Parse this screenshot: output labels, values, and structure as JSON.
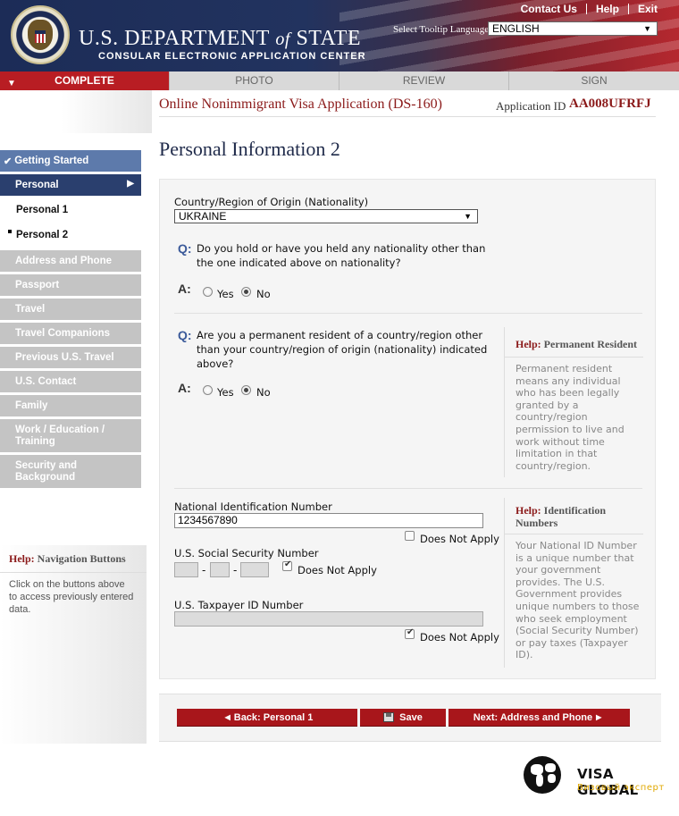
{
  "header": {
    "dept_title_part1": "U.S. Department",
    "dept_title_of": "of",
    "dept_title_part2": "State",
    "center_title": "CONSULAR ELECTRONIC APPLICATION CENTER",
    "top_links": [
      "Contact Us",
      "Help",
      "Exit"
    ],
    "tooltip_language_label": "Select Tooltip Language",
    "tooltip_language_value": "ENGLISH",
    "seal_icon": "department-seal"
  },
  "progress_tabs": [
    {
      "label": "COMPLETE",
      "state": "current"
    },
    {
      "label": "PHOTO",
      "state": "pending"
    },
    {
      "label": "REVIEW",
      "state": "pending"
    },
    {
      "label": "SIGN",
      "state": "pending"
    }
  ],
  "application": {
    "title": "Online Nonimmigrant Visa Application (DS-160)",
    "id_label": "Application ID",
    "id_value": "AA008UFRFJ"
  },
  "page_title": "Personal Information 2",
  "sidebar": {
    "getting_started": "Getting Started",
    "personal": "Personal",
    "personal_1": "Personal 1",
    "personal_2": "Personal 2",
    "items": [
      "Address and Phone",
      "Passport",
      "Travel",
      "Travel Companions",
      "Previous U.S. Travel",
      "U.S. Contact",
      "Family",
      "Work / Education / Training",
      "Security and Background"
    ],
    "work_line1": "Work / Education /",
    "work_line2": "Training",
    "security_line1": "Security and",
    "security_line2": "Background",
    "help_prefix": "Help:",
    "help_title": "Navigation Buttons",
    "help_text": "Click on the buttons above to access previously entered data."
  },
  "form": {
    "nationality_label": "Country/Region of Origin (Nationality)",
    "nationality_value": "UKRAINE",
    "q_mark": "Q:",
    "a_mark": "A:",
    "q1_text": "Do you hold or have you held any nationality other than the one indicated above on nationality?",
    "q1_answer": "No",
    "q2_text": "Are you a permanent resident of a country/region other than your country/region of origin (nationality) indicated above?",
    "q2_answer": "No",
    "yes_label": "Yes",
    "no_label": "No",
    "national_id_label": "National Identification Number",
    "national_id_value": "1234567890",
    "national_id_dna_checked": false,
    "ssn_label": "U.S. Social Security Number",
    "ssn_dna_checked": true,
    "taxpayer_label": "U.S. Taxpayer ID Number",
    "taxpayer_dna_checked": true,
    "does_not_apply": "Does Not Apply"
  },
  "help_permanent_resident": {
    "prefix": "Help:",
    "title": "Permanent Resident",
    "text": "Permanent resident means any individual who has been legally granted by a country/region permission to live and work without time limitation in that country/region."
  },
  "help_identification": {
    "prefix": "Help:",
    "title": "Identification Numbers",
    "text": "Your National ID Number is a unique number that your government provides. The U.S. Government provides unique numbers to those who seek employment (Social Security Number) or pay taxes (Taxpayer ID)."
  },
  "buttons": {
    "back": "Back: Personal 1",
    "save": "Save",
    "next": "Next: Address and Phone"
  },
  "watermark": {
    "name": "VISA GLOBAL",
    "tagline": "Визовый эксперт"
  },
  "colors": {
    "brand_red": "#b81d23",
    "navy": "#2a3f6e",
    "nav_blue": "#5d7aab",
    "nav_gray": "#c4c4c4",
    "help_red": "#8b1a1a"
  }
}
